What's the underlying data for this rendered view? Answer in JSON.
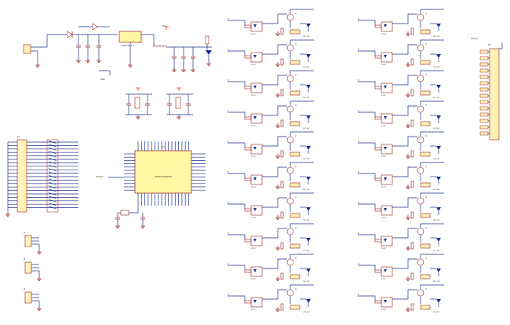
{
  "schematic": {
    "colors": {
      "wire": "#1f2f8f",
      "component": "#9b1c1c",
      "ic_fill": "#fff7a3",
      "connector_fill": "#fff2b8",
      "label": "#333333",
      "power_port": "#d11a1a"
    },
    "power": {
      "ic_label": "LM2576T-5.0",
      "net_out": "VCC",
      "gnd_label": "GND"
    },
    "mcu": {
      "designator": "U1",
      "part_label": "STM32F103RCT6",
      "net_left": "VCC3V3"
    },
    "driver_channel": {
      "opto_label": "PC817",
      "mosfet_label": "Q",
      "resistor_label": "R",
      "led_label": "LED",
      "net_label": "VIN_24V"
    },
    "left_header": {
      "designator": "P1"
    },
    "right_header": {
      "designator": "P2",
      "net": "VIN_24V"
    },
    "small_headers": [
      {
        "designator": "J1"
      },
      {
        "designator": "J2"
      },
      {
        "designator": "J3"
      }
    ]
  }
}
